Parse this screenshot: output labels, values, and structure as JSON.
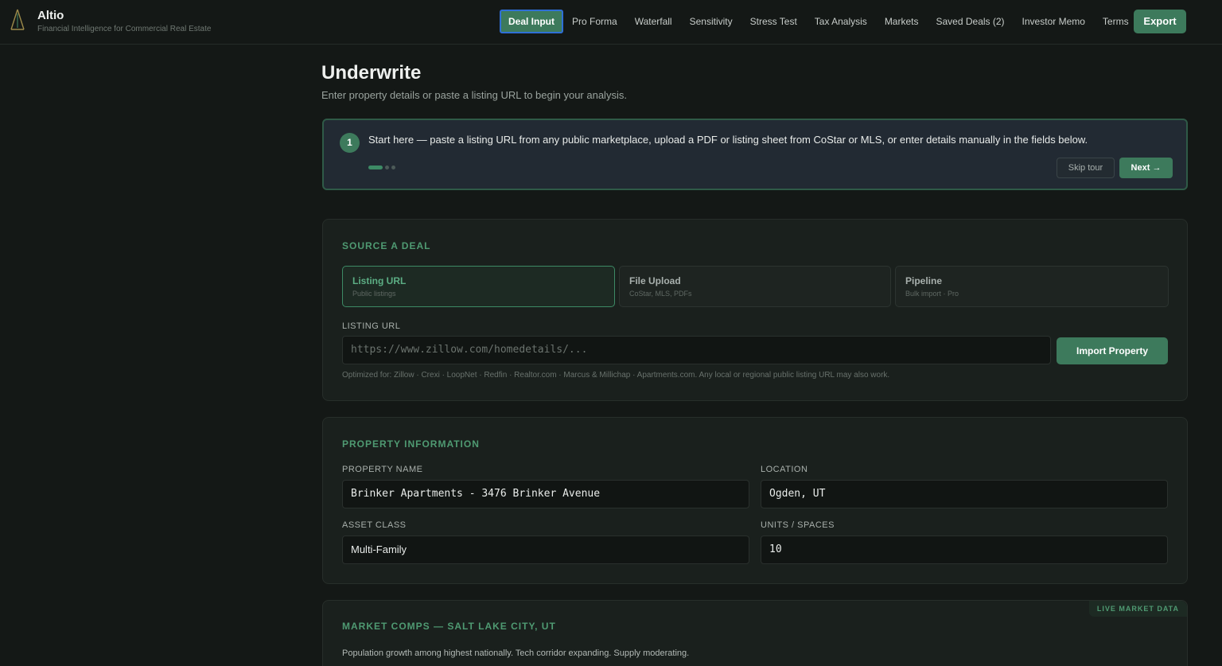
{
  "header": {
    "brand": "Altio",
    "tagline": "Financial Intelligence for Commercial Real Estate",
    "nav": [
      "Deal Input",
      "Pro Forma",
      "Waterfall",
      "Sensitivity",
      "Stress Test",
      "Tax Analysis",
      "Markets",
      "Saved Deals (2)",
      "Investor Memo",
      "Terms"
    ],
    "active_nav": "Deal Input",
    "export_label": "Export"
  },
  "page": {
    "title": "Underwrite",
    "subtitle": "Enter property details or paste a listing URL to begin your analysis."
  },
  "tour": {
    "step": "1",
    "text": "Start here — paste a listing URL from any public marketplace, upload a PDF or listing sheet from CoStar or MLS, or enter details manually in the fields below.",
    "skip_label": "Skip tour",
    "next_label": "Next →"
  },
  "source": {
    "title": "SOURCE A DEAL",
    "options": [
      {
        "label": "Listing URL",
        "sub": "Public listings"
      },
      {
        "label": "File Upload",
        "sub": "CoStar, MLS, PDFs"
      },
      {
        "label": "Pipeline",
        "sub": "Bulk import · Pro"
      }
    ],
    "url_label": "LISTING URL",
    "url_placeholder": "https://www.zillow.com/homedetails/...",
    "import_label": "Import Property",
    "hint": "Optimized for: Zillow · Crexi · LoopNet · Redfin · Realtor.com · Marcus & Millichap · Apartments.com. Any local or regional public listing URL may also work."
  },
  "property": {
    "title": "PROPERTY INFORMATION",
    "name_label": "PROPERTY NAME",
    "name_value": "Brinker Apartments - 3476 Brinker Avenue",
    "location_label": "LOCATION",
    "location_value": "Ogden, UT",
    "asset_label": "ASSET CLASS",
    "asset_value": "Multi-Family",
    "units_label": "UNITS / SPACES",
    "units_value": "10"
  },
  "comps": {
    "title": "MARKET COMPS — SALT LAKE CITY, UT",
    "badge": "LIVE MARKET DATA",
    "description": "Population growth among highest nationally. Tech corridor expanding. Supply moderating."
  },
  "colors": {
    "accent": "#3d7a5c",
    "accent_text": "#4f9a72",
    "background": "#141816"
  }
}
